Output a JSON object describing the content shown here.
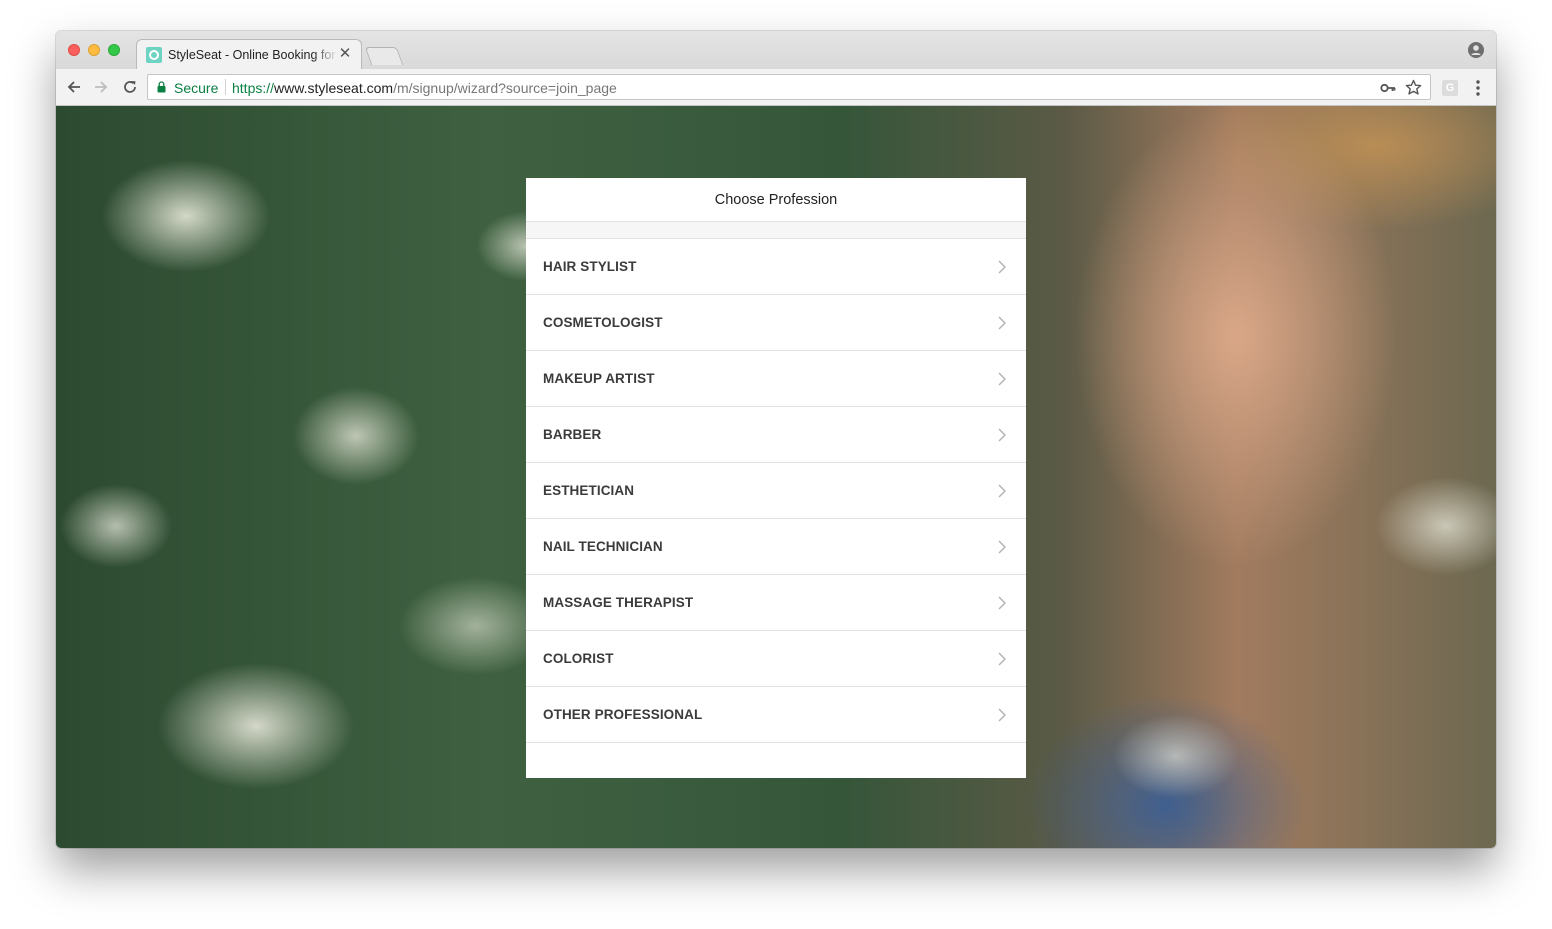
{
  "browser": {
    "tab": {
      "title": "StyleSeat - Online Booking for",
      "close_glyph": "✕"
    },
    "omnibox": {
      "secure_label": "Secure",
      "url_scheme": "https://",
      "url_host": "www.styleseat.com",
      "url_path": "/m/signup/wizard?source=join_page"
    },
    "extension_badge": "G"
  },
  "modal": {
    "title": "Choose Profession",
    "professions": [
      {
        "label": "HAIR STYLIST"
      },
      {
        "label": "COSMETOLOGIST"
      },
      {
        "label": "MAKEUP ARTIST"
      },
      {
        "label": "BARBER"
      },
      {
        "label": "ESTHETICIAN"
      },
      {
        "label": "NAIL TECHNICIAN"
      },
      {
        "label": "MASSAGE THERAPIST"
      },
      {
        "label": "COLORIST"
      },
      {
        "label": "OTHER PROFESSIONAL"
      }
    ]
  },
  "colors": {
    "secure_green": "#0b8043",
    "text_dark": "#3b3b3b",
    "divider": "#e2e2e2"
  },
  "icons": [
    "back-arrow-icon",
    "forward-arrow-icon",
    "reload-icon",
    "lock-icon",
    "key-icon",
    "star-icon",
    "profile-icon",
    "menu-icon",
    "chevron-right-icon"
  ]
}
